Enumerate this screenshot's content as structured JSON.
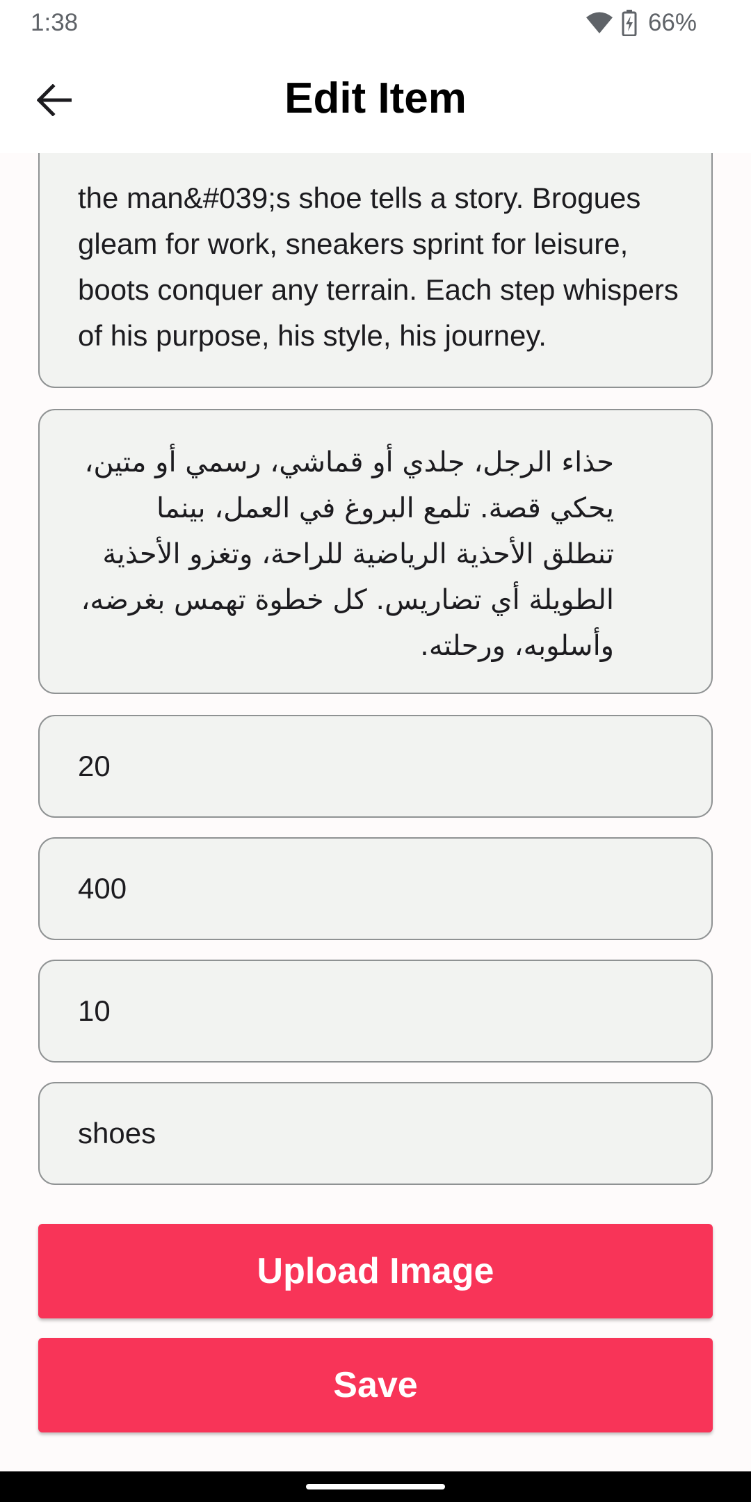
{
  "status_bar": {
    "time": "1:38",
    "battery_percent": "66%",
    "icons": [
      "wifi-icon",
      "battery-charging-icon"
    ]
  },
  "app_bar": {
    "title": "Edit Item",
    "back_icon": "arrow-left-icon"
  },
  "form": {
    "description_en": "the man&#039;s shoe tells a story. Brogues gleam for work, sneakers sprint for leisure, boots conquer any terrain. Each step whispers of his purpose, his style, his journey.",
    "description_ar": "حذاء الرجل، جلدي أو قماشي، رسمي أو متين، يحكي قصة. تلمع البروغ في العمل، بينما تنطلق الأحذية الرياضية للراحة، وتغزو الأحذية الطويلة أي تضاريس. كل خطوة تهمس بغرضه، وأسلوبه، ورحلته.",
    "field_1_value": "20",
    "field_2_value": "400",
    "field_3_value": "10",
    "field_4_value": "shoes"
  },
  "buttons": {
    "upload_label": "Upload Image",
    "save_label": "Save"
  },
  "colors": {
    "accent": "#f83458",
    "field_bg": "#f2f3f1",
    "field_border": "#8f9293"
  }
}
